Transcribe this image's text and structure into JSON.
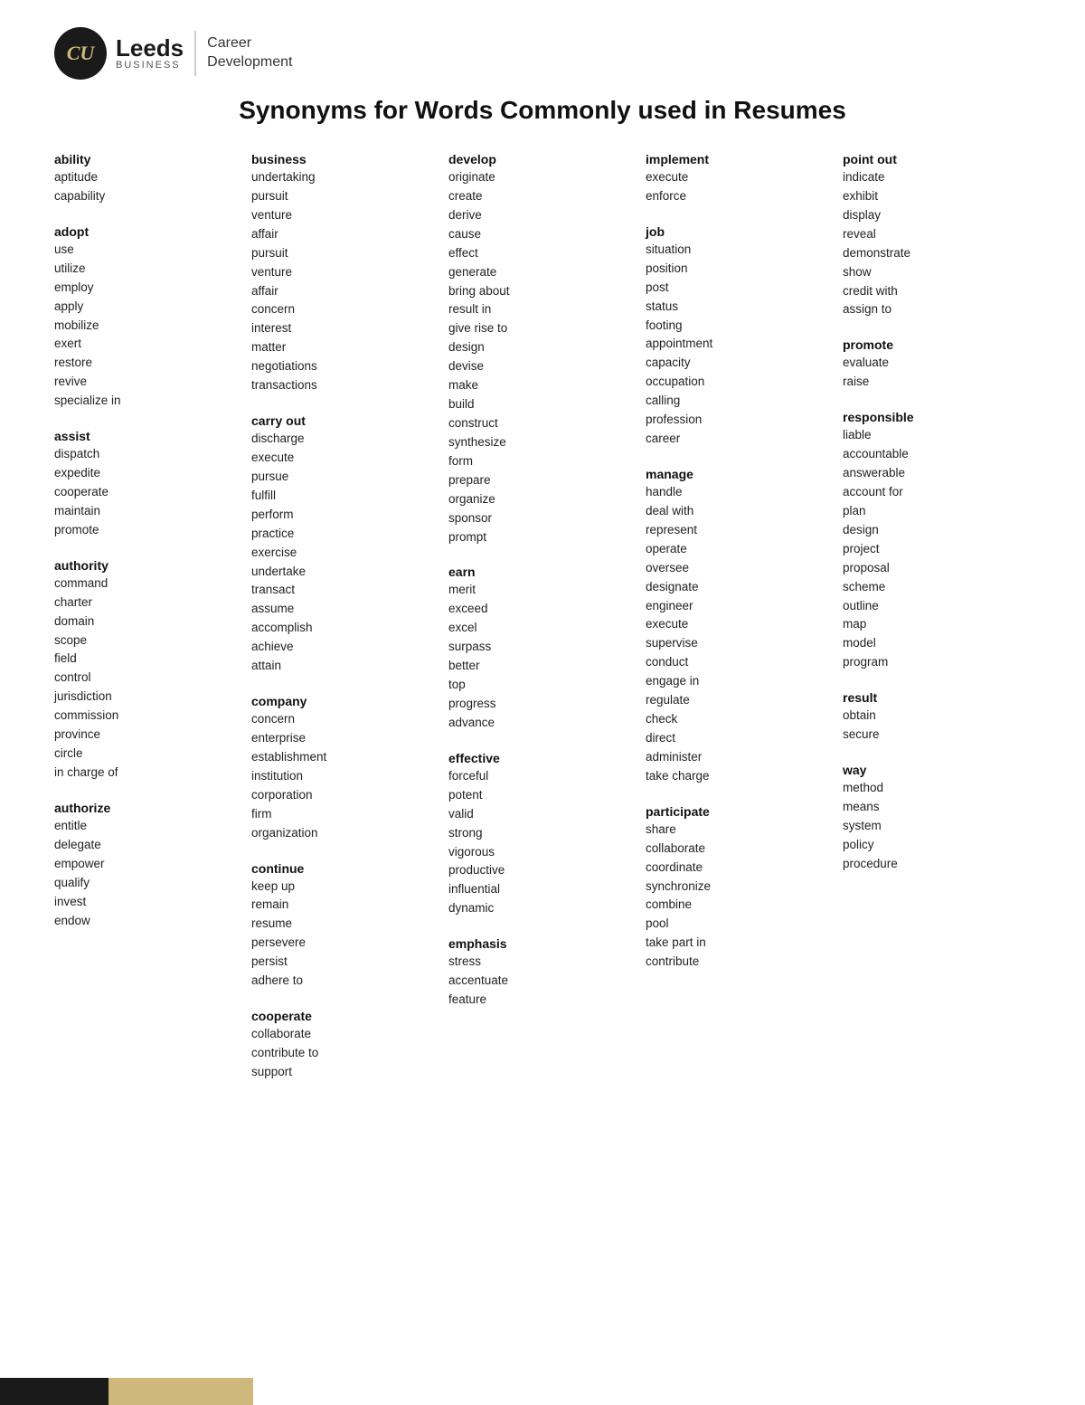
{
  "header": {
    "logo_cu": "CU",
    "logo_leeds": "Leeds",
    "logo_business": "BUSINESS",
    "logo_career": "Career",
    "logo_development": "Development"
  },
  "title": "Synonyms for Words Commonly used in Resumes",
  "columns": [
    {
      "id": "col1",
      "groups": [
        {
          "heading": "ability",
          "synonyms": [
            "aptitude",
            "capability"
          ]
        },
        {
          "heading": "adopt",
          "synonyms": [
            "use",
            "utilize",
            "employ",
            "apply",
            "mobilize",
            "exert",
            "restore",
            "revive",
            "specialize in"
          ]
        },
        {
          "heading": "assist",
          "synonyms": [
            "dispatch",
            "expedite",
            "cooperate",
            "maintain",
            "promote"
          ]
        },
        {
          "heading": "authority",
          "synonyms": [
            "command",
            "charter",
            "domain",
            "scope",
            "field",
            "control",
            "jurisdiction",
            "commission",
            "province",
            "circle",
            "in charge of"
          ]
        },
        {
          "heading": "authorize",
          "synonyms": [
            "entitle",
            "delegate",
            "empower",
            "qualify",
            "invest",
            "endow"
          ]
        }
      ]
    },
    {
      "id": "col2",
      "groups": [
        {
          "heading": "business",
          "synonyms": [
            "undertaking",
            "pursuit",
            "venture",
            "affair",
            "pursuit",
            "venture",
            "affair",
            "concern",
            "interest",
            "matter",
            "negotiations",
            "transactions"
          ]
        },
        {
          "heading": "carry out",
          "synonyms": [
            "discharge",
            "execute",
            "pursue",
            "fulfill",
            "perform",
            "practice",
            "    exercise",
            "undertake",
            "transact",
            "assume",
            "accomplish",
            "achieve",
            "attain"
          ]
        },
        {
          "heading": "company",
          "synonyms": [
            "concern",
            "enterprise",
            "establishment",
            "institution",
            "corporation",
            "firm",
            "organization"
          ]
        },
        {
          "heading": "continue",
          "synonyms": [
            "keep up",
            "remain",
            "resume",
            "persevere",
            "persist",
            "adhere to"
          ]
        },
        {
          "heading": "cooperate",
          "synonyms": [
            "collaborate",
            "contribute to",
            "support"
          ]
        }
      ]
    },
    {
      "id": "col3",
      "groups": [
        {
          "heading": "develop",
          "synonyms": [
            "originate",
            "create",
            "derive",
            "cause",
            "effect",
            "generate",
            "bring about",
            "result in",
            "give rise to",
            "design",
            "devise",
            "make",
            "build",
            "construct",
            "synthesize",
            "form",
            "prepare",
            "organize",
            "sponsor",
            "prompt"
          ]
        },
        {
          "heading": "earn",
          "synonyms": [
            "merit",
            "exceed",
            "excel",
            "surpass",
            "better",
            "top",
            "progress",
            "advance"
          ]
        },
        {
          "heading": "effective",
          "synonyms": [
            "forceful",
            "potent",
            "valid",
            "strong",
            "vigorous",
            "productive",
            "influential",
            "dynamic"
          ]
        },
        {
          "heading": "emphasis",
          "synonyms": [
            "stress",
            "accentuate",
            "feature"
          ]
        }
      ]
    },
    {
      "id": "col4",
      "groups": [
        {
          "heading": "implement",
          "synonyms": [
            "execute",
            "enforce"
          ]
        },
        {
          "heading": "job",
          "synonyms": [
            "situation",
            "position",
            "post",
            "status",
            "footing",
            "appointment",
            "capacity",
            "occupation",
            "calling",
            "profession",
            "career"
          ]
        },
        {
          "heading": "manage",
          "synonyms": [
            "handle",
            "deal with",
            "represent",
            "operate",
            "oversee",
            "designate",
            "engineer",
            "execute",
            "supervise",
            "conduct",
            "engage in",
            "regulate",
            "check",
            "direct",
            "administer",
            "take charge"
          ]
        },
        {
          "heading": "participate",
          "synonyms": [
            "share",
            "collaborate",
            "coordinate",
            "synchronize",
            "combine",
            "pool",
            "take part in",
            "contribute"
          ]
        }
      ]
    },
    {
      "id": "col5",
      "groups": [
        {
          "heading": "point out",
          "synonyms": [
            "indicate",
            "exhibit",
            "display",
            "reveal",
            "demonstrate",
            "show",
            "credit with",
            "assign to"
          ]
        },
        {
          "heading": "promote",
          "synonyms": [
            "evaluate",
            "raise"
          ]
        },
        {
          "heading": "responsible",
          "synonyms": [
            "liable",
            "accountable",
            "answerable",
            "account for",
            "plan",
            "design",
            "project",
            "proposal",
            "scheme",
            "outline",
            "map",
            "model",
            "program"
          ]
        },
        {
          "heading": "result",
          "synonyms": [
            "obtain",
            "secure"
          ]
        },
        {
          "heading": "way",
          "synonyms": [
            "method",
            "means",
            "system",
            "policy",
            "procedure"
          ]
        }
      ]
    }
  ]
}
